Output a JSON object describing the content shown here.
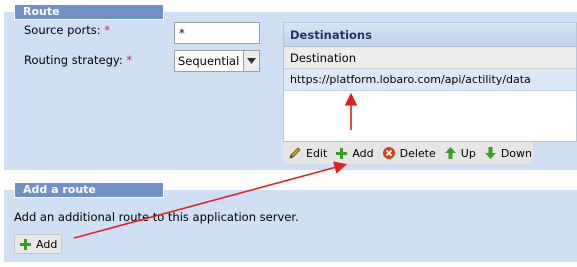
{
  "route": {
    "legend": "Route",
    "source_ports_label": "Source ports:",
    "source_ports_value": "*",
    "strategy_label": "Routing strategy:",
    "strategy_value": "Sequential",
    "required_marker": "*"
  },
  "destinations": {
    "title": "Destinations",
    "column_header": "Destination",
    "rows": [
      "https://platform.lobaro.com/api/actility/data"
    ],
    "toolbar": {
      "edit": "Edit",
      "add": "Add",
      "delete": "Delete",
      "up": "Up",
      "down": "Down"
    }
  },
  "add_route": {
    "legend": "Add a route",
    "description": "Add an additional route to this application server.",
    "button": "Add"
  },
  "colors": {
    "panel_bg": "#cfe0f5",
    "legend_bg": "#7090c8",
    "required": "#e02020",
    "arrow": "#e02020"
  },
  "icons": [
    "pencil-icon",
    "plus-icon",
    "delete-icon",
    "up-arrow-icon",
    "down-arrow-icon",
    "dropdown-arrow-icon"
  ]
}
